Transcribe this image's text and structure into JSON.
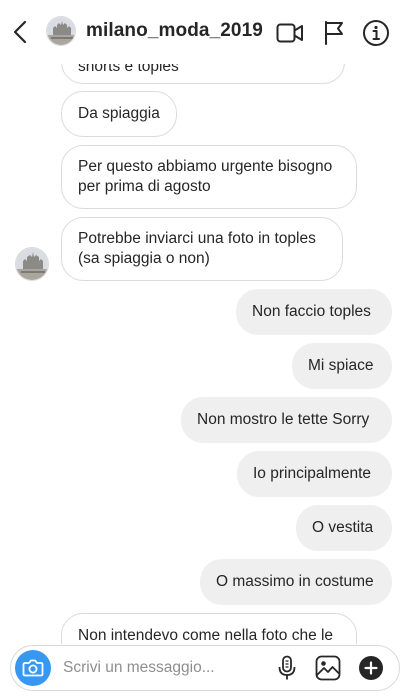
{
  "header": {
    "username": "milano_moda_2019",
    "icons": [
      "back-icon",
      "video-call-icon",
      "flag-icon",
      "info-icon"
    ]
  },
  "messages": [
    {
      "from": "them",
      "text": "shorts e toples"
    },
    {
      "from": "them",
      "text": "Da spiaggia"
    },
    {
      "from": "them",
      "text": "Per questo abbiamo urgente bisogno per prima di agosto"
    },
    {
      "from": "them",
      "text": "Potrebbe inviarci una foto in toples (sa spiaggia o non)"
    },
    {
      "from": "me",
      "text": "Non faccio toples"
    },
    {
      "from": "me",
      "text": "Mi spiace"
    },
    {
      "from": "me",
      "text": "Non mostro le tette Sorry"
    },
    {
      "from": "me",
      "text": "Io principalmente"
    },
    {
      "from": "me",
      "text": "O vestita"
    },
    {
      "from": "me",
      "text": "O massimo in costume"
    },
    {
      "from": "them",
      "text": "Non intendevo come nella foto che le"
    }
  ],
  "composer": {
    "placeholder": "Scrivi un messaggio...",
    "icons": [
      "camera-icon",
      "microphone-icon",
      "gallery-icon",
      "add-icon"
    ]
  },
  "colors": {
    "accent": "#3897f0",
    "incoming_border": "#dbdbdb",
    "outgoing_bg": "#efefef",
    "text": "#262626",
    "placeholder": "#8e8e8e"
  }
}
